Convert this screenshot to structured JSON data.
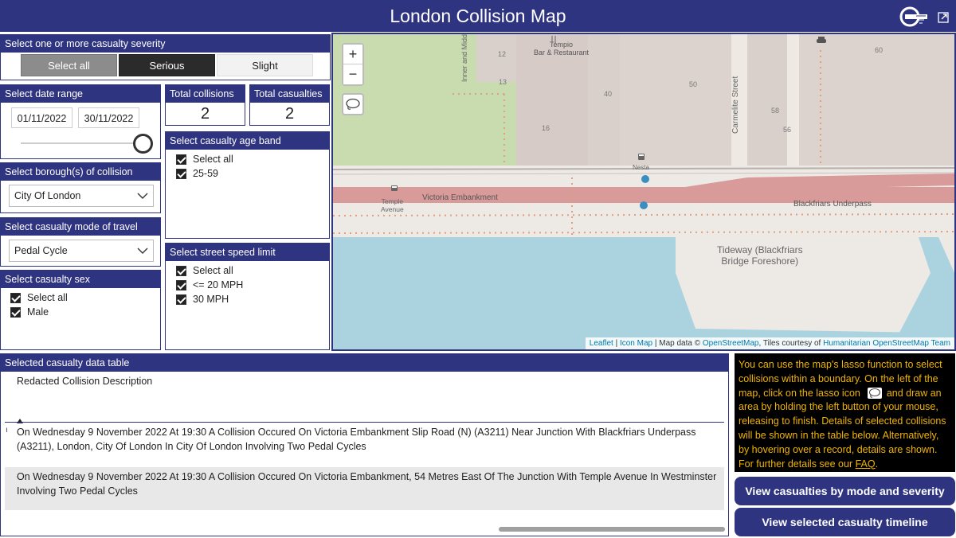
{
  "title": "London Collision Map",
  "severity": {
    "header": "Select one or more casualty severity",
    "options": [
      "Select all",
      "Serious",
      "Slight"
    ]
  },
  "date_range": {
    "header": "Select date range",
    "start": "01/11/2022",
    "end": "30/11/2022"
  },
  "borough": {
    "header": "Select borough(s) of collision",
    "value": "City Of London"
  },
  "mode": {
    "header": "Select casualty mode of travel",
    "value": "Pedal Cycle"
  },
  "sex": {
    "header": "Select casualty sex",
    "items": [
      "Select all",
      "Male"
    ]
  },
  "kpi": {
    "collisions_label": "Total collisions",
    "collisions_value": "2",
    "casualties_label": "Total casualties",
    "casualties_value": "2"
  },
  "age_band": {
    "header": "Select casualty age band",
    "items": [
      "Select all",
      "25-59"
    ]
  },
  "speed": {
    "header": "Select street speed limit",
    "items": [
      "Select all",
      "<= 20 MPH",
      "30 MPH"
    ]
  },
  "map": {
    "labels": {
      "tempio": "Tempio\nBar & Restaurant",
      "n12": "12",
      "n13": "13",
      "n16": "16",
      "n40": "40",
      "n50": "50",
      "n56": "56",
      "n58": "58",
      "n60": "60",
      "inner_middle": "Inner and Middle Temples",
      "carmelite": "Carmelite Street",
      "nesta": "Nesta",
      "temple_avenue": "Temple\nAvenue",
      "victoria_embankment": "Victoria Embankment",
      "blackfriars_underpass": "Blackfriars Underpass",
      "tideway": "Tideway (Blackfriars\nBridge Foreshore)"
    },
    "attribution": {
      "leaflet": "Leaflet",
      "sep1": " | ",
      "icon_map": "Icon Map",
      "mid": " | Map data © ",
      "osm": "OpenStreetMap",
      "tiles": ", Tiles courtesy of ",
      "hot": "Humanitarian OpenStreetMap Team"
    },
    "zoom_in": "+",
    "zoom_out": "−"
  },
  "table": {
    "header": "Selected casualty data table",
    "column": "Redacted Collision Description",
    "rows": [
      "On Wednesday 9 November 2022 At 19:30 A Collision Occured On Victoria Embankment Slip Road (N) (A3211) Near Junction With Blackfriars Underpass (A3211), London, City Of London In City Of London Involving Two Pedal Cycles",
      "On Wednesday 9 November 2022 At 19:30 A Collision Occured On Victoria Embankment, 54 Metres East Of The Junction With Temple Avenue In Westminster Involving Two Pedal Cycles"
    ]
  },
  "help": {
    "part1": "You can use the map's lasso function to select collisions within a boundary. On the left of the map, click on the lasso icon",
    "part2": "and draw an area by holding the left button of your mouse, releasing to finish. Details of selected collisions will be shown in the table below. Alternatively, by hovering over a record, details are shown. For further details see our",
    "faq": "FAQ",
    "end": "."
  },
  "buttons": {
    "mode_severity": "View casualties by mode and severity",
    "timeline": "View selected casualty timeline"
  },
  "colors": {
    "header": "#2f3480",
    "help_bg": "#000000",
    "help_text": "#f0b400",
    "road": "#d99a9a",
    "water": "#aad3df",
    "park": "#c8dcb0",
    "dot": "#3a8fc0"
  }
}
